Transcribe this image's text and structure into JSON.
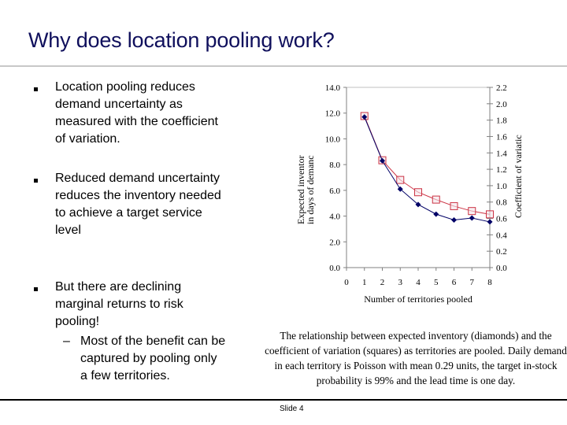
{
  "slide": {
    "title": "Why does location pooling work?",
    "slide_number": "Slide 4"
  },
  "bullets": [
    {
      "text": "Location pooling reduces demand uncertainty as measured with the coefficient of variation."
    },
    {
      "text": "Reduced demand uncertainty reduces the inventory needed to achieve a target service level"
    },
    {
      "text": "But there are declining marginal returns to risk pooling!",
      "sub": [
        {
          "text": "Most of the benefit can be captured by pooling only a few territories."
        }
      ]
    }
  ],
  "sub_marker": "–",
  "caption": "The relationship between expected inventory (diamonds) and the coefficient of variation (squares) as territories are pooled.  Daily demand in each territory is Poisson with mean 0.29 units, the target in-stock probability is 99% and the lead time is one day.",
  "chart_data": {
    "type": "line",
    "title": "",
    "xlabel": "Number of territories pooled",
    "ylabel": "Expected inventor in days of demanc",
    "ylabel_lines": [
      "Expected inventor",
      "in days of demanc"
    ],
    "y2label": "Coefficient of variatic",
    "x": [
      1,
      2,
      3,
      4,
      5,
      6,
      7,
      8
    ],
    "xlim": [
      0,
      8
    ],
    "x_ticks": [
      "0",
      "1",
      "2",
      "3",
      "4",
      "5",
      "6",
      "7",
      "8"
    ],
    "ylim": [
      0,
      14
    ],
    "y_ticks": [
      "0.0",
      "2.0",
      "4.0",
      "6.0",
      "8.0",
      "10.0",
      "12.0",
      "14.0"
    ],
    "y2lim": [
      0,
      2.2
    ],
    "y2_ticks": [
      "0.0",
      "0.2",
      "0.4",
      "0.6",
      "0.8",
      "1.0",
      "1.2",
      "1.4",
      "1.6",
      "1.8",
      "2.0",
      "2.2"
    ],
    "grid": false,
    "series": [
      {
        "name": "Expected inventory (diamonds)",
        "axis": "left",
        "marker": "diamond",
        "color": "#000066",
        "values": [
          11.7,
          8.3,
          6.1,
          4.9,
          4.15,
          3.7,
          3.85,
          3.55
        ]
      },
      {
        "name": "Coefficient of variation (squares)",
        "axis": "right",
        "marker": "square",
        "color": "#cc3344",
        "values": [
          1.85,
          1.31,
          1.07,
          0.92,
          0.83,
          0.75,
          0.69,
          0.65
        ]
      }
    ]
  }
}
